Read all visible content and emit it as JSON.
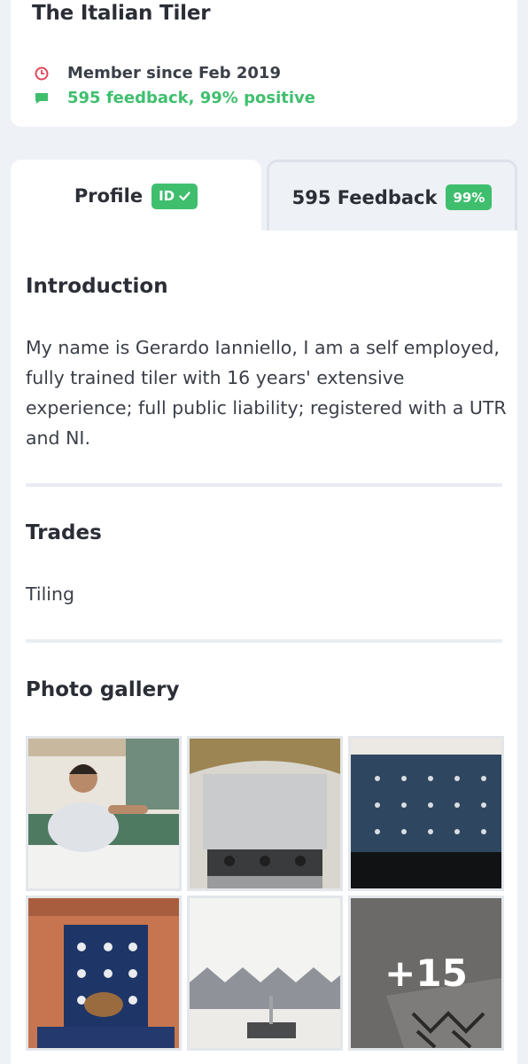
{
  "header": {
    "business_name": "The Italian Tiler",
    "member_since": "Member since Feb 2019",
    "feedback_summary": "595 feedback, 99% positive"
  },
  "tabs": {
    "profile": {
      "label": "Profile",
      "badge": "ID"
    },
    "feedback": {
      "label": "595 Feedback",
      "badge": "99%"
    }
  },
  "introduction": {
    "title": "Introduction",
    "text": "My name is Gerardo Ianniello, I am a self employed, fully trained tiler with 16 years' extensive experience; full public liability; registered with a UTR and NI."
  },
  "trades": {
    "title": "Trades",
    "items": "Tiling"
  },
  "gallery": {
    "title": "Photo gallery",
    "more_count": "+15"
  },
  "colors": {
    "accent_green": "#3fbf6e",
    "clock_red": "#e0475a",
    "background": "#eef1f6"
  }
}
